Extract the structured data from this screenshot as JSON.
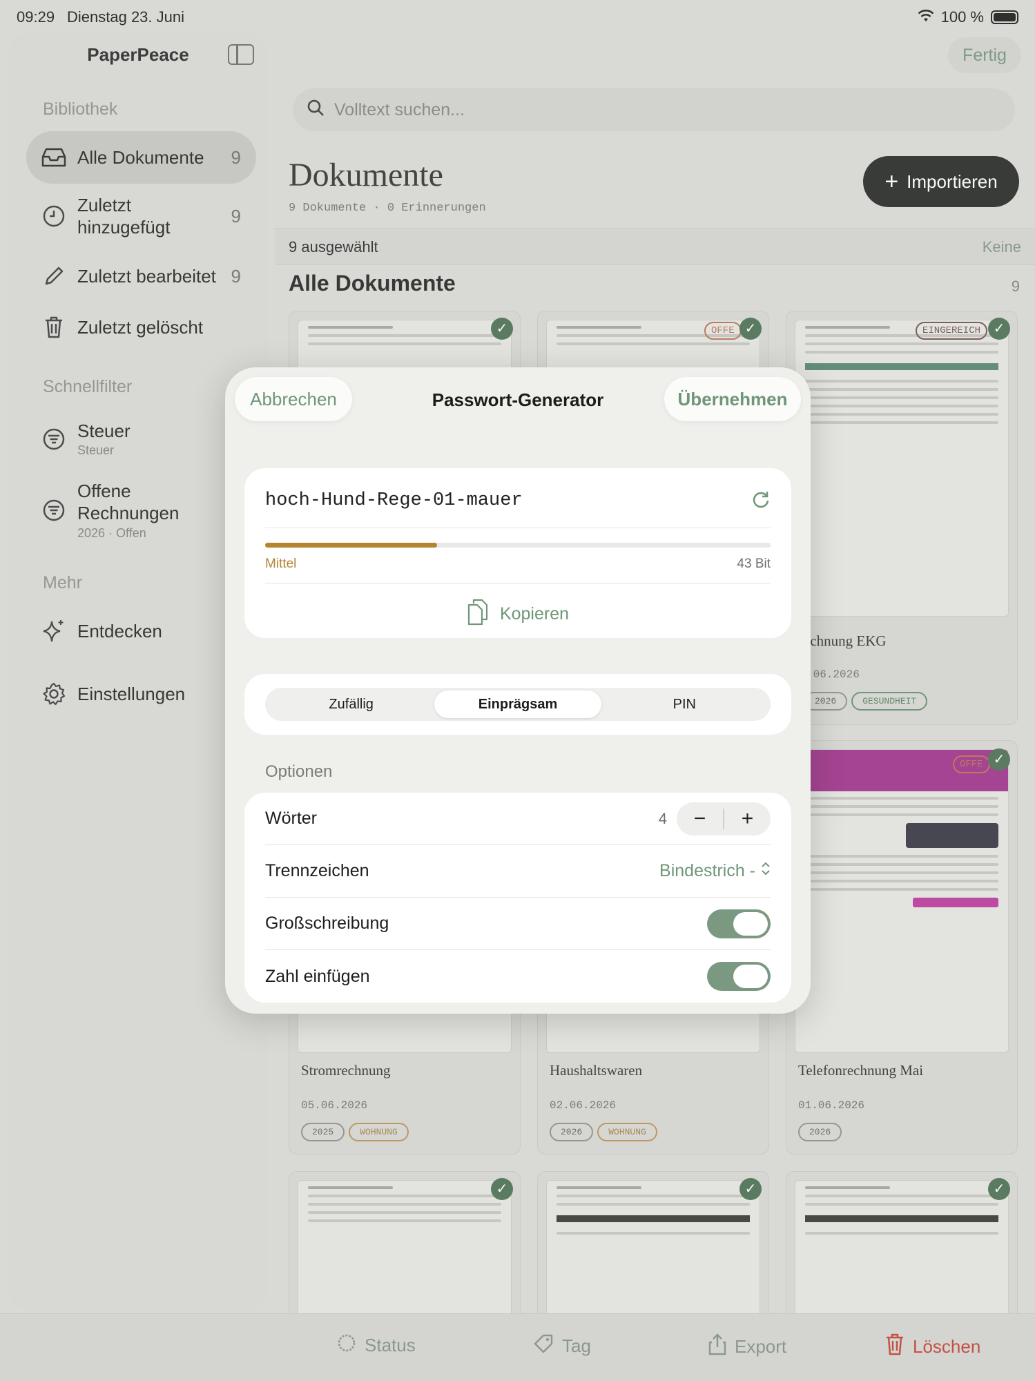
{
  "status": {
    "time": "09:29",
    "date": "Dienstag 23. Juni",
    "battery": "100 %"
  },
  "sidebar": {
    "title": "PaperPeace",
    "library_label": "Bibliothek",
    "items": [
      {
        "label": "Alle Dokumente",
        "count": "9"
      },
      {
        "label": "Zuletzt hinzugefügt",
        "count": "9"
      },
      {
        "label": "Zuletzt bearbeitet",
        "count": "9"
      },
      {
        "label": "Zuletzt gelöscht",
        "count": ""
      }
    ],
    "filters_label": "Schnellfilter",
    "filters": [
      {
        "label": "Steuer",
        "sub": "Steuer"
      },
      {
        "label": "Offene Rechnungen",
        "sub": "2026 · Offen"
      }
    ],
    "more_label": "Mehr",
    "more": [
      {
        "label": "Entdecken"
      },
      {
        "label": "Einstellungen"
      }
    ]
  },
  "header": {
    "done": "Fertig",
    "search_placeholder": "Volltext suchen...",
    "title": "Dokumente",
    "subtitle": "9 Dokumente · 0 Erinnerungen",
    "import": "Importieren",
    "selected": "9 ausgewählt",
    "none": "Keine",
    "section_title": "Alle Dokumente",
    "section_count": "9"
  },
  "cards": [
    {
      "title": "Stromrechnung",
      "date": "05.06.2026",
      "tags": [
        "2025",
        "WOHNUNG"
      ]
    },
    {
      "title": "Haushaltswaren",
      "date": "02.06.2026",
      "tags": [
        "2026",
        "WOHNUNG"
      ]
    },
    {
      "title": "Telefonrechnung Mai",
      "date": "01.06.2026",
      "tags": [
        "2026"
      ]
    },
    {
      "title": "echnung EKG",
      "date": ".06.2026",
      "tags": [
        "2026",
        "GESUNDHEIT"
      ]
    }
  ],
  "stamps": {
    "offen": "OFFE",
    "eingereicht": "EINGEREICH"
  },
  "toolbar": {
    "status": "Status",
    "tag": "Tag",
    "export": "Export",
    "delete": "Löschen"
  },
  "modal": {
    "cancel": "Abbrechen",
    "title": "Passwort-Generator",
    "apply": "Übernehmen",
    "password": "hoch-Hund-Rege-01-mauer",
    "strength_label": "Mittel",
    "strength_fraction": 0.34,
    "bits": "43 Bit",
    "copy": "Kopieren",
    "modes": [
      "Zufällig",
      "Einprägsam",
      "PIN"
    ],
    "selected_mode": "Einprägsam",
    "options_label": "Optionen",
    "words_label": "Wörter",
    "words_value": "4",
    "separator_label": "Trennzeichen",
    "separator_value": "Bindestrich  -",
    "capitalize_label": "Großschreibung",
    "capitalize_on": true,
    "number_label": "Zahl einfügen",
    "number_on": true
  },
  "colors": {
    "accent": "#6f9677",
    "strength": "#b6832f",
    "danger": "#c0392b"
  }
}
